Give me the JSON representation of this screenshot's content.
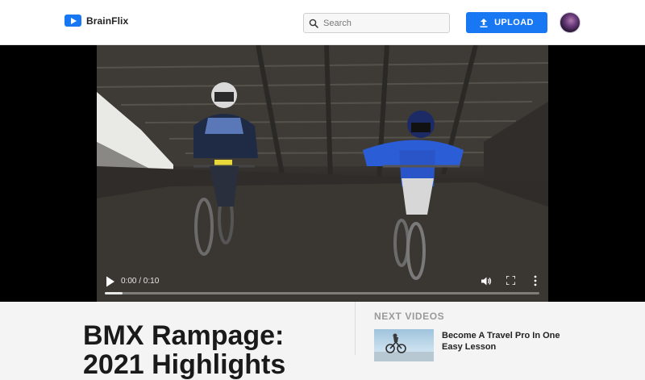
{
  "app": {
    "name": "BrainFlix"
  },
  "header": {
    "search": {
      "placeholder": "Search",
      "value": ""
    },
    "upload_label": "UPLOAD"
  },
  "player": {
    "time_display": "0:00 / 0:10",
    "progress": 0.04
  },
  "video": {
    "title": "BMX Rampage: 2021 Highlights"
  },
  "sidebar": {
    "heading": "NEXT VIDEOS",
    "items": [
      {
        "title": "Become A Travel Pro In One Easy Lesson"
      }
    ]
  },
  "colors": {
    "accent": "#1877f2",
    "background": "#f4f4f4",
    "header_bg": "#ffffff",
    "player_bg": "#000000"
  },
  "icons": {
    "logo": "play-logo-icon",
    "search": "search-icon",
    "upload": "upload-icon",
    "play": "play-icon",
    "volume": "volume-icon",
    "fullscreen": "fullscreen-icon",
    "more": "more-vertical-icon"
  }
}
